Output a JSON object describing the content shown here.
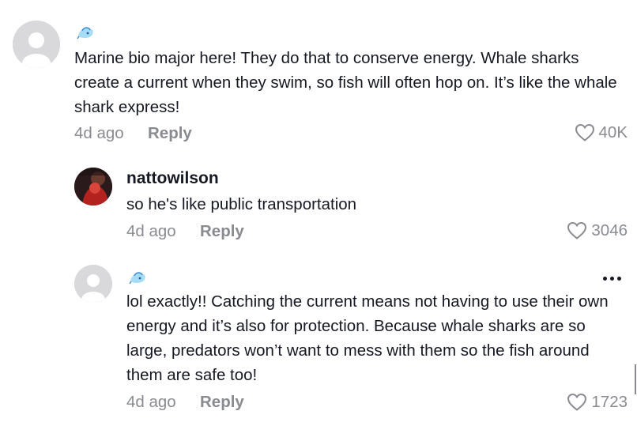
{
  "comments": [
    {
      "username": "",
      "has_badge": true,
      "text": "Marine bio major here! They do that to conserve energy. Whale sharks create a current when they swim, so fish will often hop on. It’s like the whale shark express!",
      "time": "4d ago",
      "reply_label": "Reply",
      "likes": "40K"
    },
    {
      "username": "nattowilson",
      "has_badge": false,
      "text": "so he's like public transportation",
      "time": "4d ago",
      "reply_label": "Reply",
      "likes": "3046"
    },
    {
      "username": "",
      "has_badge": true,
      "text": "lol exactly!! Catching the current means not having to use their own energy and it’s also for protection. Because whale sharks are so large, predators won’t want to mess with them so the fish around them are safe too!",
      "time": "4d ago",
      "reply_label": "Reply",
      "likes": "1723"
    }
  ],
  "icons": {
    "like": "heart-outline-icon",
    "more": "more-options-icon",
    "badge": "sticker-icon",
    "avatar_default": "default-avatar-icon"
  },
  "colors": {
    "text": "#161823",
    "muted": "#8a8b91",
    "avatar_placeholder": "#d9d9dc"
  }
}
